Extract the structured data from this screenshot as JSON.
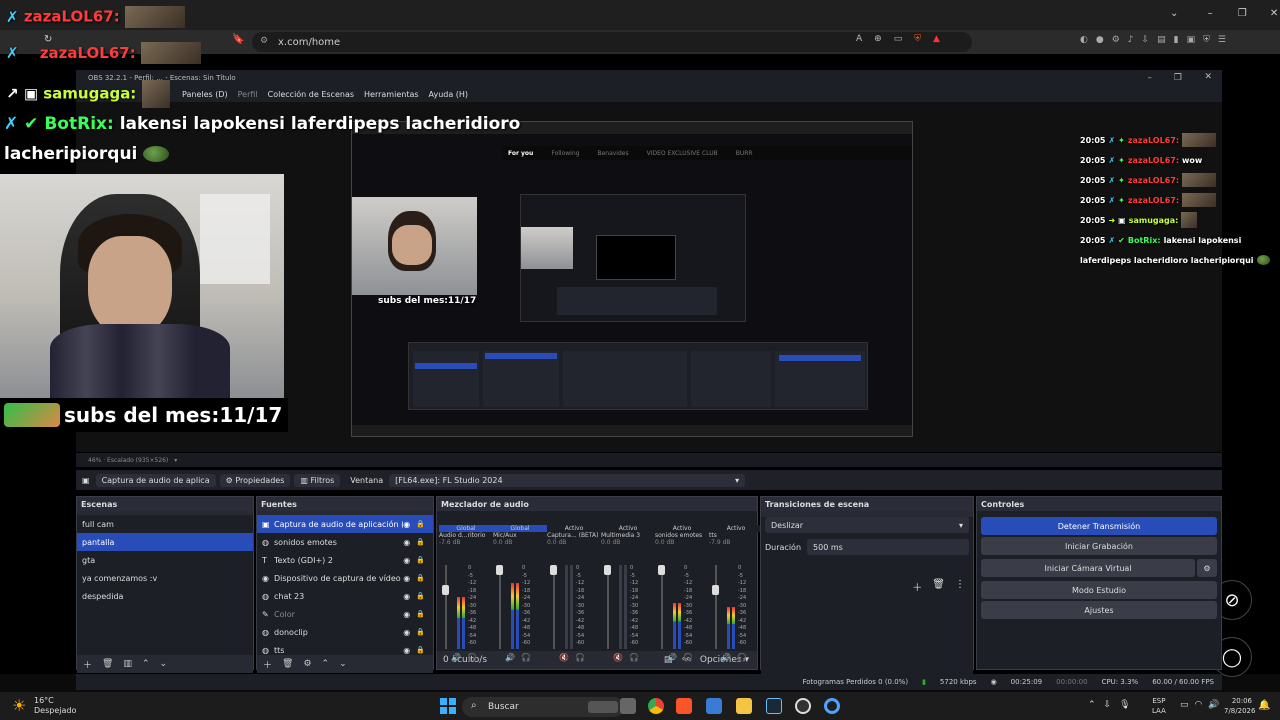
{
  "browser": {
    "url": "x.com/home"
  },
  "obs": {
    "title": "OBS 32.2.1 - Perfil: ... - Escenas: Sin Título",
    "menu": [
      "Paneles (D)",
      "Perfil",
      "Colección de Escenas",
      "Herramientas",
      "Ayuda (H)"
    ],
    "source_toolbar": {
      "selected_source": "Captura de audio de aplica",
      "properties_label": "Propiedades",
      "filters_label": "Filtros",
      "window_label": "Ventana",
      "window_value": "[FL64.exe]: FL Studio 2024"
    },
    "preview_status": "46% · Escalado (935×526)",
    "scenes": {
      "title": "Escenas",
      "items": [
        "full cam",
        "pantalla",
        "gta",
        "ya comenzamos :v",
        "despedida"
      ],
      "selected": "pantalla"
    },
    "sources": {
      "title": "Fuentes",
      "items": [
        {
          "label": "Captura de audio de aplicación (F",
          "icon": "audio-capture-icon"
        },
        {
          "label": "sonidos emotes",
          "icon": "globe-icon"
        },
        {
          "label": "Texto (GDI+) 2",
          "icon": "text-icon"
        },
        {
          "label": "Dispositivo de captura de vídeo 3",
          "icon": "camera-icon"
        },
        {
          "label": "chat 23",
          "icon": "globe-icon"
        },
        {
          "label": "Color",
          "icon": "brush-icon"
        },
        {
          "label": "donoclip",
          "icon": "globe-icon"
        },
        {
          "label": "tts",
          "icon": "globe-icon"
        }
      ]
    },
    "mixer": {
      "title": "Mezclador de audio",
      "channels": [
        {
          "tag": "Global",
          "name": "Audio d...ritorio",
          "db": "-7.6 dB",
          "level": 0.62
        },
        {
          "tag": "Global",
          "name": "Mic/Aux",
          "db": "0.0 dB",
          "level": 0.78
        },
        {
          "tag": "Activo",
          "name": "Captura... (BETA)",
          "db": "0.0 dB",
          "level": 0.0
        },
        {
          "tag": "Activo",
          "name": "Multimedia 3",
          "db": "0.0 dB",
          "level": 0.0
        },
        {
          "tag": "Activo",
          "name": "sonidos emotes",
          "db": "0.0 dB",
          "level": 0.55
        },
        {
          "tag": "Activo",
          "name": "tts",
          "db": "-7.9 dB",
          "level": 0.5
        }
      ],
      "scale": [
        "0",
        "-5",
        "-12",
        "-18",
        "-24",
        "-30",
        "-36",
        "-42",
        "-48",
        "-54",
        "-60"
      ],
      "hidden": "0 oculto/s",
      "options_label": "Opciones"
    },
    "transitions": {
      "title": "Transiciones de escena",
      "type": "Deslizar",
      "duration_label": "Duración",
      "duration_value": "500 ms"
    },
    "controls": {
      "title": "Controles",
      "buttons": [
        "Detener Transmisión",
        "Iniciar Grabación",
        "Iniciar Cámara Virtual",
        "Modo Estudio",
        "Ajustes"
      ]
    },
    "stats": {
      "frames": "Fotogramas Perdidos 0 (0.0%)",
      "bitrate": "5720 kbps",
      "stream_time": "00:25:09",
      "rec_time": "00:00:00",
      "cpu": "CPU: 3.3%",
      "fps": "60.00 / 60.00 FPS"
    }
  },
  "overlay": {
    "chat": [
      {
        "user": "zazaLOL67:",
        "color_class": "zazal",
        "text": ""
      },
      {
        "user": "zazaLOL67:",
        "color_class": "zazal",
        "text": ""
      },
      {
        "user": "samugaga:",
        "color_class": "samu",
        "text": ""
      },
      {
        "user": "BotRix:",
        "color_class": "botrix",
        "text": "lakensi lapokensi laferdipeps lacheridioro"
      }
    ],
    "chat_continuation": "lacheripiorqui",
    "subs": "subs del mes:11/17",
    "right_chat": [
      {
        "time": "20:05",
        "user": "zazaLOL67:",
        "text": ""
      },
      {
        "time": "20:05",
        "user": "zazaLOL67:",
        "text": "wow"
      },
      {
        "time": "20:05",
        "user": "zazaLOL67:",
        "text": ""
      },
      {
        "time": "20:05",
        "user": "zazaLOL67:",
        "text": ""
      },
      {
        "time": "20:05",
        "user": "samugaga:",
        "text": ""
      },
      {
        "time": "20:05",
        "user": "BotRix:",
        "text": "lakensi lapokensi"
      }
    ],
    "right_chat_tail": "laferdipeps lacheridioro lacheripiorqui"
  },
  "taskbar": {
    "weather_temp": "16°C",
    "weather_desc": "Despejado",
    "search_placeholder": "Buscar",
    "lang": "ESP",
    "lang_sub": "LAA",
    "time": "20:06",
    "date": "7/8/2026"
  }
}
